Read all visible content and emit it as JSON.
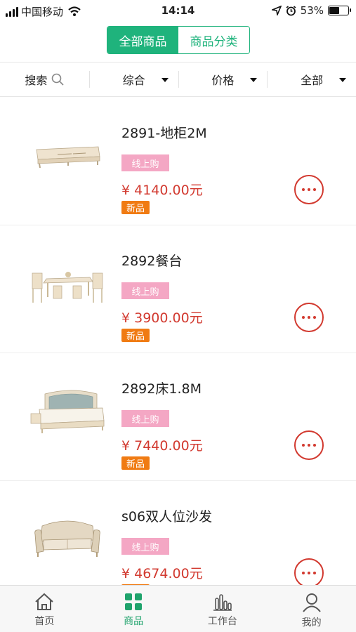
{
  "status_bar": {
    "carrier": "中国移动",
    "time": "14:14",
    "battery": "53%"
  },
  "segment": {
    "all_products": "全部商品",
    "categories": "商品分类"
  },
  "filter": {
    "search": "搜索",
    "sort": "综合",
    "price": "价格",
    "all": "全部"
  },
  "products": [
    {
      "name": "2891-地柜2M",
      "tag": "线上购",
      "price": "¥ 4140.00元",
      "badge": "新品"
    },
    {
      "name": "2892餐台",
      "tag": "线上购",
      "price": "¥ 3900.00元",
      "badge": "新品"
    },
    {
      "name": "2892床1.8M",
      "tag": "线上购",
      "price": "¥ 7440.00元",
      "badge": "新品"
    },
    {
      "name": "s06双人位沙发",
      "tag": "线上购",
      "price": "¥ 4674.00元",
      "badge": "新品"
    }
  ],
  "tabbar": {
    "home": "首页",
    "products": "商品",
    "workbench": "工作台",
    "mine": "我的"
  },
  "colors": {
    "accent": "#1fb37c",
    "price": "#d2392f",
    "tag": "#f4a7c4",
    "badge": "#f07b13"
  }
}
